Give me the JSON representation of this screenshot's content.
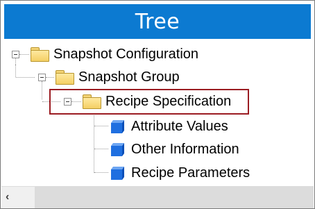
{
  "panel": {
    "title": "Tree"
  },
  "tree": {
    "nodes": [
      {
        "label": "Snapshot Configuration",
        "icon": "folder-icon",
        "expanded": true
      },
      {
        "label": "Snapshot Group",
        "icon": "folder-icon",
        "expanded": true
      },
      {
        "label": "Recipe Specification",
        "icon": "folder-icon",
        "expanded": true,
        "highlighted": true
      },
      {
        "label": "Attribute Values",
        "icon": "cube-icon"
      },
      {
        "label": "Other Information",
        "icon": "cube-icon"
      },
      {
        "label": "Recipe Parameters",
        "icon": "cube-icon"
      }
    ]
  },
  "scrollbar": {
    "left_arrow": "‹"
  },
  "colors": {
    "header": "#0c7ad1",
    "highlight_border": "#9b1c22",
    "cube": "#1f6fe0",
    "folder": "#f4cf64"
  }
}
